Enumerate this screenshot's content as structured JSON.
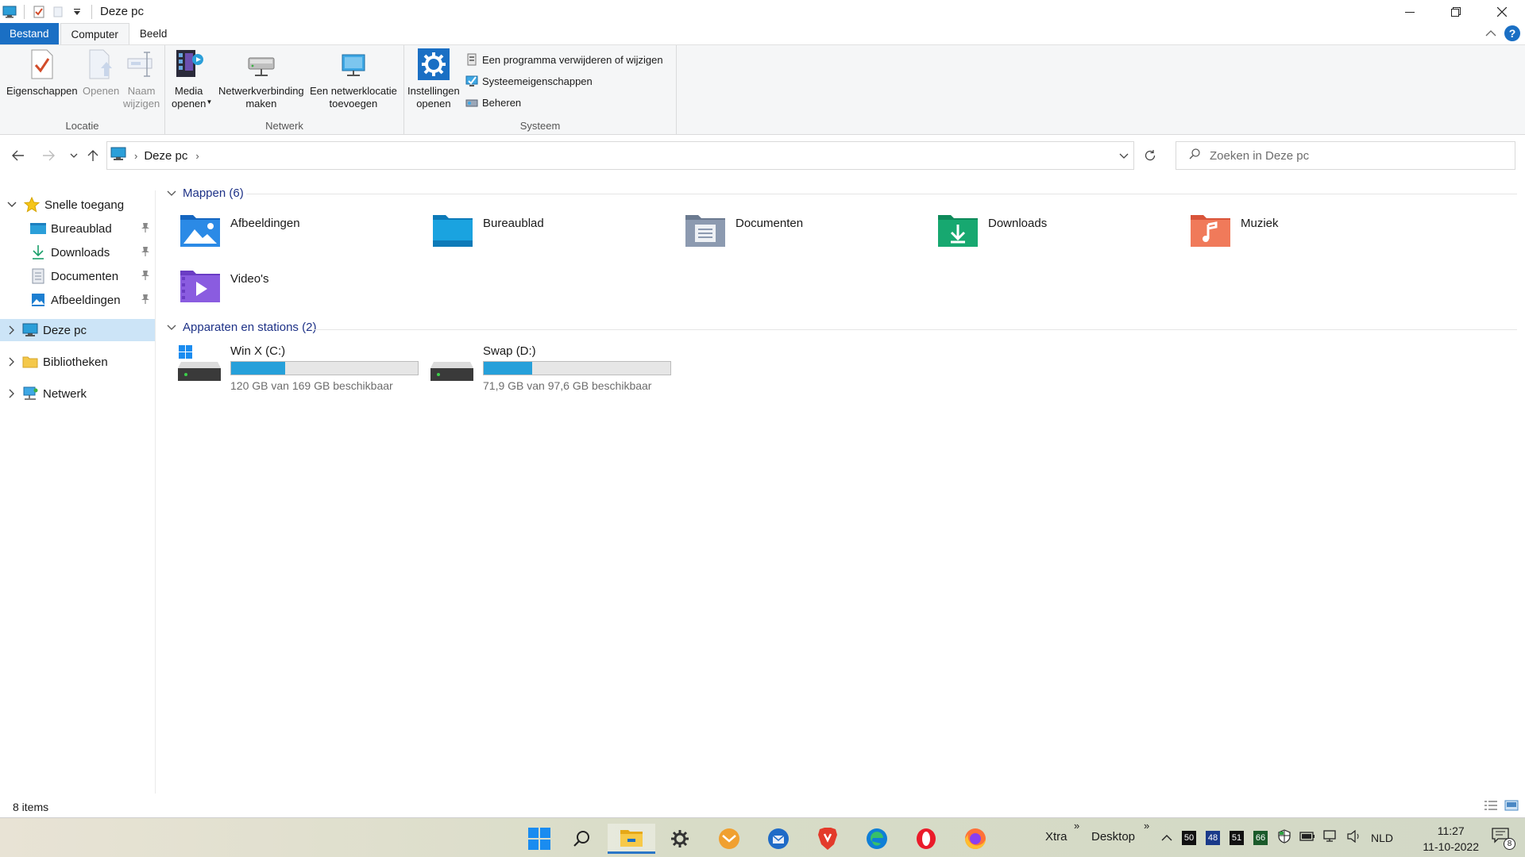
{
  "window": {
    "title": "Deze pc"
  },
  "ribbon": {
    "tabs": [
      "Bestand",
      "Computer",
      "Beeld"
    ],
    "groups": {
      "locatie": {
        "label": "Locatie",
        "buttons": [
          {
            "label": "Eigenschappen"
          },
          {
            "label": "Openen"
          },
          {
            "label1": "Naam",
            "label2": "wijzigen"
          }
        ]
      },
      "netwerk": {
        "label": "Netwerk",
        "buttons": [
          {
            "label1": "Media",
            "label2": "openen"
          },
          {
            "label1": "Netwerkverbinding",
            "label2": "maken"
          },
          {
            "label1": "Een netwerklocatie",
            "label2": "toevoegen"
          }
        ]
      },
      "systeem": {
        "label": "Systeem",
        "settings": {
          "label1": "Instellingen",
          "label2": "openen"
        },
        "small": [
          {
            "label": "Een programma verwijderen of wijzigen"
          },
          {
            "label": "Systeemeigenschappen"
          },
          {
            "label": "Beheren"
          }
        ]
      }
    }
  },
  "address": {
    "crumb": "Deze pc",
    "search_placeholder": "Zoeken in Deze pc"
  },
  "sidebar": {
    "quick_access": "Snelle toegang",
    "pinned": [
      "Bureaublad",
      "Downloads",
      "Documenten",
      "Afbeeldingen"
    ],
    "this_pc": "Deze pc",
    "libraries": "Bibliotheken",
    "network": "Netwerk"
  },
  "content": {
    "folders_header": "Mappen (6)",
    "folders": [
      "Afbeeldingen",
      "Bureaublad",
      "Documenten",
      "Downloads",
      "Muziek",
      "Video's"
    ],
    "drives_header": "Apparaten en stations (2)",
    "drives": [
      {
        "name": "Win X (C:)",
        "free": "120 GB van 169 GB beschikbaar",
        "used_fraction": 0.29
      },
      {
        "name": "Swap (D:)",
        "free": "71,9 GB van 97,6 GB beschikbaar",
        "used_fraction": 0.26
      }
    ]
  },
  "status": {
    "items": "8 items"
  },
  "taskbar": {
    "toolbar1": "Xtra",
    "toolbar2": "Desktop",
    "tray_numbers": [
      "50",
      "48",
      "51",
      "66"
    ],
    "language": "NLD",
    "time": "11:27",
    "date": "11-10-2022",
    "notification_count": "8"
  },
  "colors": {
    "accent": "#1a6fc4",
    "drive_bar": "#26a0da",
    "selected": "#cce4f7"
  }
}
